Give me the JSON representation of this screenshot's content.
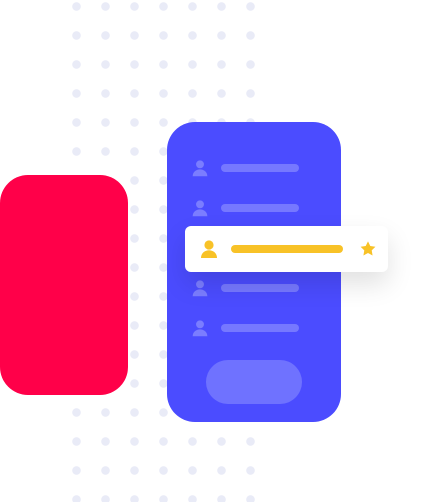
{
  "colors": {
    "background": "#ffffff",
    "dot": "#e9ebf7",
    "red_card": "#ff0049",
    "phone": "#4b4cff",
    "phone_bar": "#7b7dff",
    "phone_button": "#6f72ff",
    "highlight": "#f8c227",
    "highlight_card": "#ffffff"
  },
  "icons": {
    "user": "user-icon",
    "star": "star-icon"
  }
}
